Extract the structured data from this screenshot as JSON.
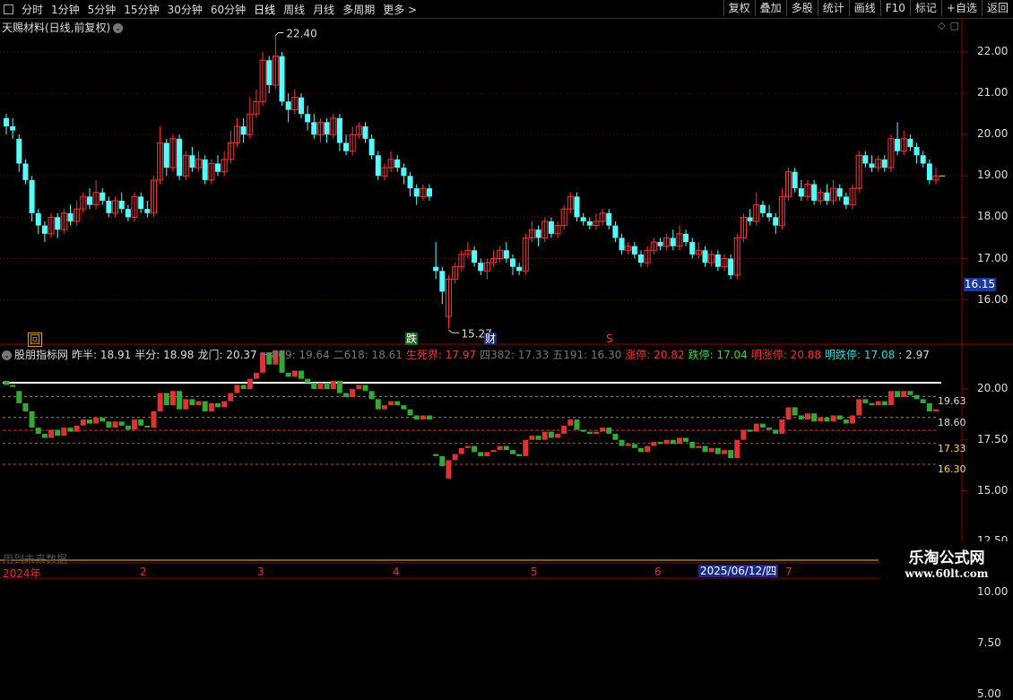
{
  "toolbar": {
    "left_items": [
      "分时",
      "1分钟",
      "5分钟",
      "15分钟",
      "30分钟",
      "60分钟",
      "日线",
      "周线",
      "月线",
      "多周期",
      "更多 >"
    ],
    "active_item": "日线",
    "right_items": [
      "复权",
      "叠加",
      "多股",
      "统计",
      "画线",
      "F10",
      "标记",
      "+自选",
      "返回"
    ]
  },
  "pane": {
    "title": "天赐材料(日线,前复权)",
    "dropdown_icon": "chevron-down-icon",
    "marker_high": "22.40",
    "marker_low": "15.27",
    "current_price": "16.15",
    "signal_left": "回",
    "signal_die": "跌",
    "signal_cai": "财",
    "signal_s": "S"
  },
  "price_axis": [
    "22.00",
    "21.00",
    "20.00",
    "19.00",
    "18.00",
    "17.00",
    "16.00"
  ],
  "indicator": {
    "name": "股朋指标网",
    "items": [
      {
        "label": "昨半: 18.91",
        "color": "#dddddd"
      },
      {
        "label": "半分: 18.98",
        "color": "#dddddd"
      },
      {
        "label": "龙门: 20.37",
        "color": "#dddddd"
      },
      {
        "label": "一809: 19.64",
        "color": "#777777"
      },
      {
        "label": "二618: 18.61",
        "color": "#777777"
      },
      {
        "label": "生死界: 17.97",
        "color": "#ff3333"
      },
      {
        "label": "四382: 17.33",
        "color": "#777777"
      },
      {
        "label": "五191: 16.30",
        "color": "#777777"
      },
      {
        "label": "涨停: 20.82",
        "color": "#ff3333"
      },
      {
        "label": "跌停: 17.04",
        "color": "#33dd33"
      },
      {
        "label": "明涨停: 20.88",
        "color": "#ff3333"
      },
      {
        "label": "明跌停: 17.08",
        "color": "#33dddd"
      },
      {
        "label": ": 2.97",
        "color": "#dddddd"
      }
    ],
    "right_values": [
      "19.63",
      "18.60",
      "17.33",
      "16.30"
    ],
    "axis": [
      "20.00",
      "17.50",
      "15.00",
      "12.50",
      "10.00",
      "7.50",
      "5.00"
    ]
  },
  "timeline": {
    "labels": [
      "2024年",
      "2",
      "3",
      "4",
      "5",
      "6",
      "7"
    ],
    "current_date": "2025/06/12/四",
    "future_text": "用到未来数据"
  },
  "watermark": {
    "line1": "乐淘公式网",
    "line2": "www.60lt.com"
  },
  "colors": {
    "up": "#ff3232",
    "down": "#54ffff",
    "grid": "#8b0000",
    "bg": "#000000"
  },
  "chart_data": {
    "type": "candlestick",
    "title": "天赐材料(日线,前复权)",
    "ylim": [
      15.0,
      22.6
    ],
    "high_marker": 22.4,
    "low_marker": 15.27,
    "last_price": 16.15,
    "candles": [
      {
        "o": 20.4,
        "c": 20.2,
        "h": 20.5,
        "l": 20.0
      },
      {
        "o": 20.2,
        "c": 20.1,
        "h": 20.4,
        "l": 19.9
      },
      {
        "o": 19.9,
        "c": 19.3,
        "h": 20.0,
        "l": 19.1
      },
      {
        "o": 19.3,
        "c": 18.9,
        "h": 19.4,
        "l": 18.8
      },
      {
        "o": 18.9,
        "c": 18.1,
        "h": 19.0,
        "l": 17.9
      },
      {
        "o": 18.1,
        "c": 17.8,
        "h": 18.2,
        "l": 17.6
      },
      {
        "o": 17.8,
        "c": 17.6,
        "h": 17.9,
        "l": 17.4
      },
      {
        "o": 17.6,
        "c": 18.0,
        "h": 18.1,
        "l": 17.5
      },
      {
        "o": 18.0,
        "c": 17.7,
        "h": 18.1,
        "l": 17.5
      },
      {
        "o": 17.7,
        "c": 18.1,
        "h": 18.2,
        "l": 17.6
      },
      {
        "o": 18.1,
        "c": 17.9,
        "h": 18.3,
        "l": 17.8
      },
      {
        "o": 17.9,
        "c": 18.2,
        "h": 18.4,
        "l": 17.8
      },
      {
        "o": 18.2,
        "c": 18.5,
        "h": 18.6,
        "l": 18.1
      },
      {
        "o": 18.5,
        "c": 18.3,
        "h": 18.7,
        "l": 18.2
      },
      {
        "o": 18.3,
        "c": 18.6,
        "h": 18.9,
        "l": 18.2
      },
      {
        "o": 18.6,
        "c": 18.4,
        "h": 18.7,
        "l": 18.3
      },
      {
        "o": 18.4,
        "c": 18.1,
        "h": 18.5,
        "l": 18.0
      },
      {
        "o": 18.1,
        "c": 18.4,
        "h": 18.5,
        "l": 18.0
      },
      {
        "o": 18.4,
        "c": 18.2,
        "h": 18.6,
        "l": 18.1
      },
      {
        "o": 18.2,
        "c": 18.0,
        "h": 18.3,
        "l": 17.9
      },
      {
        "o": 18.0,
        "c": 18.5,
        "h": 18.6,
        "l": 17.9
      },
      {
        "o": 18.5,
        "c": 18.2,
        "h": 18.6,
        "l": 18.1
      },
      {
        "o": 18.2,
        "c": 18.1,
        "h": 18.4,
        "l": 18.0
      },
      {
        "o": 18.1,
        "c": 18.9,
        "h": 19.0,
        "l": 18.0
      },
      {
        "o": 18.9,
        "c": 19.8,
        "h": 20.2,
        "l": 18.8
      },
      {
        "o": 19.8,
        "c": 19.2,
        "h": 19.9,
        "l": 19.0
      },
      {
        "o": 19.2,
        "c": 19.9,
        "h": 20.0,
        "l": 19.1
      },
      {
        "o": 19.9,
        "c": 19.0,
        "h": 20.0,
        "l": 18.9
      },
      {
        "o": 19.0,
        "c": 19.5,
        "h": 19.6,
        "l": 18.9
      },
      {
        "o": 19.5,
        "c": 19.2,
        "h": 19.7,
        "l": 19.1
      },
      {
        "o": 19.2,
        "c": 19.4,
        "h": 19.6,
        "l": 19.1
      },
      {
        "o": 19.4,
        "c": 18.9,
        "h": 19.5,
        "l": 18.8
      },
      {
        "o": 18.9,
        "c": 19.3,
        "h": 19.4,
        "l": 18.8
      },
      {
        "o": 19.3,
        "c": 19.1,
        "h": 19.5,
        "l": 19.0
      },
      {
        "o": 19.1,
        "c": 19.4,
        "h": 19.6,
        "l": 19.0
      },
      {
        "o": 19.4,
        "c": 19.8,
        "h": 20.1,
        "l": 19.3
      },
      {
        "o": 19.8,
        "c": 20.2,
        "h": 20.4,
        "l": 19.7
      },
      {
        "o": 20.2,
        "c": 20.0,
        "h": 20.4,
        "l": 19.8
      },
      {
        "o": 20.0,
        "c": 20.5,
        "h": 20.9,
        "l": 19.9
      },
      {
        "o": 20.5,
        "c": 20.8,
        "h": 21.1,
        "l": 20.4
      },
      {
        "o": 20.8,
        "c": 21.8,
        "h": 22.0,
        "l": 20.7
      },
      {
        "o": 21.8,
        "c": 21.2,
        "h": 21.9,
        "l": 21.0
      },
      {
        "o": 21.2,
        "c": 21.9,
        "h": 22.4,
        "l": 21.1
      },
      {
        "o": 21.9,
        "c": 20.8,
        "h": 22.0,
        "l": 20.7
      },
      {
        "o": 20.8,
        "c": 20.6,
        "h": 21.0,
        "l": 20.3
      },
      {
        "o": 20.6,
        "c": 20.9,
        "h": 21.1,
        "l": 20.5
      },
      {
        "o": 20.9,
        "c": 20.5,
        "h": 21.0,
        "l": 20.4
      },
      {
        "o": 20.5,
        "c": 20.3,
        "h": 20.7,
        "l": 20.1
      },
      {
        "o": 20.3,
        "c": 20.0,
        "h": 20.5,
        "l": 19.9
      },
      {
        "o": 20.0,
        "c": 20.3,
        "h": 20.4,
        "l": 19.8
      },
      {
        "o": 20.3,
        "c": 20.0,
        "h": 20.4,
        "l": 19.8
      },
      {
        "o": 20.0,
        "c": 20.4,
        "h": 20.5,
        "l": 19.9
      },
      {
        "o": 20.4,
        "c": 19.8,
        "h": 20.5,
        "l": 19.6
      },
      {
        "o": 19.8,
        "c": 19.6,
        "h": 20.0,
        "l": 19.5
      },
      {
        "o": 19.6,
        "c": 20.0,
        "h": 20.2,
        "l": 19.5
      },
      {
        "o": 20.0,
        "c": 20.2,
        "h": 20.3,
        "l": 19.9
      },
      {
        "o": 20.2,
        "c": 19.9,
        "h": 20.3,
        "l": 19.8
      },
      {
        "o": 19.9,
        "c": 19.5,
        "h": 20.0,
        "l": 19.4
      },
      {
        "o": 19.5,
        "c": 19.0,
        "h": 19.6,
        "l": 18.9
      },
      {
        "o": 19.0,
        "c": 19.2,
        "h": 19.3,
        "l": 18.9
      },
      {
        "o": 19.2,
        "c": 19.4,
        "h": 19.6,
        "l": 19.1
      },
      {
        "o": 19.4,
        "c": 19.2,
        "h": 19.5,
        "l": 19.1
      },
      {
        "o": 19.2,
        "c": 19.0,
        "h": 19.3,
        "l": 18.8
      },
      {
        "o": 19.0,
        "c": 18.7,
        "h": 19.1,
        "l": 18.5
      },
      {
        "o": 18.7,
        "c": 18.5,
        "h": 18.8,
        "l": 18.3
      },
      {
        "o": 18.5,
        "c": 18.7,
        "h": 18.8,
        "l": 18.4
      },
      {
        "o": 18.7,
        "c": 18.5,
        "h": 18.8,
        "l": 18.4
      },
      {
        "o": 16.8,
        "c": 16.7,
        "h": 17.4,
        "l": 16.5
      },
      {
        "o": 16.7,
        "c": 16.2,
        "h": 16.8,
        "l": 15.9
      },
      {
        "o": 15.6,
        "c": 16.5,
        "h": 16.6,
        "l": 15.3
      },
      {
        "o": 16.5,
        "c": 16.8,
        "h": 16.9,
        "l": 16.4
      },
      {
        "o": 16.8,
        "c": 17.1,
        "h": 17.2,
        "l": 16.7
      },
      {
        "o": 17.1,
        "c": 17.2,
        "h": 17.4,
        "l": 17.0
      },
      {
        "o": 17.2,
        "c": 16.9,
        "h": 17.3,
        "l": 16.8
      },
      {
        "o": 16.9,
        "c": 16.7,
        "h": 17.0,
        "l": 16.6
      },
      {
        "o": 16.7,
        "c": 16.9,
        "h": 17.0,
        "l": 16.5
      },
      {
        "o": 16.9,
        "c": 17.0,
        "h": 17.2,
        "l": 16.8
      },
      {
        "o": 17.0,
        "c": 17.2,
        "h": 17.3,
        "l": 16.9
      },
      {
        "o": 17.2,
        "c": 17.0,
        "h": 17.4,
        "l": 16.9
      },
      {
        "o": 17.0,
        "c": 16.8,
        "h": 17.1,
        "l": 16.6
      },
      {
        "o": 16.8,
        "c": 16.7,
        "h": 16.9,
        "l": 16.6
      },
      {
        "o": 16.7,
        "c": 17.5,
        "h": 17.6,
        "l": 16.6
      },
      {
        "o": 17.5,
        "c": 17.7,
        "h": 17.9,
        "l": 17.4
      },
      {
        "o": 17.7,
        "c": 17.5,
        "h": 17.8,
        "l": 17.3
      },
      {
        "o": 17.5,
        "c": 17.9,
        "h": 18.0,
        "l": 17.4
      },
      {
        "o": 17.9,
        "c": 17.6,
        "h": 18.0,
        "l": 17.5
      },
      {
        "o": 17.6,
        "c": 17.8,
        "h": 17.9,
        "l": 17.5
      },
      {
        "o": 17.8,
        "c": 18.2,
        "h": 18.3,
        "l": 17.7
      },
      {
        "o": 18.2,
        "c": 18.5,
        "h": 18.6,
        "l": 18.1
      },
      {
        "o": 18.5,
        "c": 18.0,
        "h": 18.6,
        "l": 17.9
      },
      {
        "o": 18.0,
        "c": 17.9,
        "h": 18.1,
        "l": 17.8
      },
      {
        "o": 17.9,
        "c": 17.8,
        "h": 18.0,
        "l": 17.7
      },
      {
        "o": 17.8,
        "c": 17.9,
        "h": 18.1,
        "l": 17.7
      },
      {
        "o": 17.9,
        "c": 18.1,
        "h": 18.2,
        "l": 17.8
      },
      {
        "o": 18.1,
        "c": 17.8,
        "h": 18.2,
        "l": 17.7
      },
      {
        "o": 17.8,
        "c": 17.5,
        "h": 17.9,
        "l": 17.4
      },
      {
        "o": 17.5,
        "c": 17.2,
        "h": 17.6,
        "l": 17.1
      },
      {
        "o": 17.2,
        "c": 17.3,
        "h": 17.4,
        "l": 17.1
      },
      {
        "o": 17.3,
        "c": 17.1,
        "h": 17.4,
        "l": 17.0
      },
      {
        "o": 17.1,
        "c": 16.9,
        "h": 17.2,
        "l": 16.8
      },
      {
        "o": 16.9,
        "c": 17.2,
        "h": 17.3,
        "l": 16.8
      },
      {
        "o": 17.2,
        "c": 17.4,
        "h": 17.5,
        "l": 17.1
      },
      {
        "o": 17.4,
        "c": 17.3,
        "h": 17.5,
        "l": 17.2
      },
      {
        "o": 17.3,
        "c": 17.5,
        "h": 17.6,
        "l": 17.2
      },
      {
        "o": 17.5,
        "c": 17.3,
        "h": 17.7,
        "l": 17.2
      },
      {
        "o": 17.3,
        "c": 17.6,
        "h": 17.8,
        "l": 17.2
      },
      {
        "o": 17.6,
        "c": 17.4,
        "h": 17.7,
        "l": 17.3
      },
      {
        "o": 17.4,
        "c": 17.1,
        "h": 17.5,
        "l": 17.0
      },
      {
        "o": 17.1,
        "c": 17.2,
        "h": 17.4,
        "l": 17.0
      },
      {
        "o": 17.2,
        "c": 16.9,
        "h": 17.3,
        "l": 16.8
      },
      {
        "o": 16.9,
        "c": 17.1,
        "h": 17.2,
        "l": 16.8
      },
      {
        "o": 17.1,
        "c": 16.8,
        "h": 17.2,
        "l": 16.7
      },
      {
        "o": 16.8,
        "c": 17.0,
        "h": 17.1,
        "l": 16.7
      },
      {
        "o": 17.0,
        "c": 16.6,
        "h": 17.1,
        "l": 16.5
      },
      {
        "o": 16.6,
        "c": 17.5,
        "h": 17.6,
        "l": 16.5
      },
      {
        "o": 17.5,
        "c": 18.0,
        "h": 18.1,
        "l": 17.4
      },
      {
        "o": 18.0,
        "c": 17.9,
        "h": 18.2,
        "l": 17.8
      },
      {
        "o": 17.9,
        "c": 18.3,
        "h": 18.6,
        "l": 17.8
      },
      {
        "o": 18.3,
        "c": 18.1,
        "h": 18.4,
        "l": 18.0
      },
      {
        "o": 18.1,
        "c": 18.0,
        "h": 18.3,
        "l": 17.9
      },
      {
        "o": 18.0,
        "c": 17.8,
        "h": 18.1,
        "l": 17.6
      },
      {
        "o": 17.8,
        "c": 18.5,
        "h": 18.7,
        "l": 17.7
      },
      {
        "o": 18.5,
        "c": 19.1,
        "h": 19.2,
        "l": 18.4
      },
      {
        "o": 19.1,
        "c": 18.7,
        "h": 19.2,
        "l": 18.6
      },
      {
        "o": 18.7,
        "c": 18.5,
        "h": 18.9,
        "l": 18.4
      },
      {
        "o": 18.5,
        "c": 18.8,
        "h": 18.9,
        "l": 18.4
      },
      {
        "o": 18.8,
        "c": 18.4,
        "h": 18.9,
        "l": 18.3
      },
      {
        "o": 18.4,
        "c": 18.6,
        "h": 18.7,
        "l": 18.3
      },
      {
        "o": 18.6,
        "c": 18.4,
        "h": 18.8,
        "l": 18.3
      },
      {
        "o": 18.4,
        "c": 18.7,
        "h": 18.9,
        "l": 18.3
      },
      {
        "o": 18.7,
        "c": 18.5,
        "h": 18.8,
        "l": 18.4
      },
      {
        "o": 18.5,
        "c": 18.3,
        "h": 18.6,
        "l": 18.2
      },
      {
        "o": 18.3,
        "c": 18.7,
        "h": 18.8,
        "l": 18.2
      },
      {
        "o": 18.7,
        "c": 19.5,
        "h": 19.6,
        "l": 18.6
      },
      {
        "o": 19.5,
        "c": 19.3,
        "h": 19.6,
        "l": 19.2
      },
      {
        "o": 19.3,
        "c": 19.2,
        "h": 19.5,
        "l": 19.1
      },
      {
        "o": 19.2,
        "c": 19.4,
        "h": 19.5,
        "l": 19.1
      },
      {
        "o": 19.4,
        "c": 19.2,
        "h": 19.5,
        "l": 19.1
      },
      {
        "o": 19.2,
        "c": 19.9,
        "h": 20.0,
        "l": 19.1
      },
      {
        "o": 19.9,
        "c": 19.6,
        "h": 20.3,
        "l": 19.5
      },
      {
        "o": 19.6,
        "c": 19.9,
        "h": 20.1,
        "l": 19.5
      },
      {
        "o": 19.9,
        "c": 19.7,
        "h": 20.0,
        "l": 19.6
      },
      {
        "o": 19.7,
        "c": 19.5,
        "h": 19.8,
        "l": 19.3
      },
      {
        "o": 19.5,
        "c": 19.3,
        "h": 19.6,
        "l": 19.2
      },
      {
        "o": 19.3,
        "c": 18.9,
        "h": 19.4,
        "l": 18.8
      },
      {
        "o": 18.9,
        "c": 19.0,
        "h": 19.2,
        "l": 18.8
      }
    ]
  }
}
